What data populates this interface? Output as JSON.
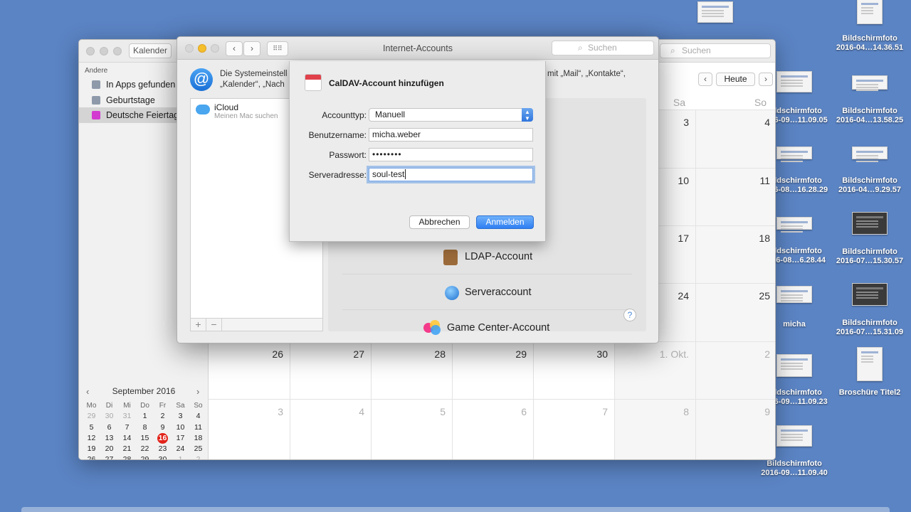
{
  "desktop": {
    "items": [
      {
        "label": ""
      },
      {
        "label": "Bildschirmfoto\n2016-04…14.36.51"
      },
      {
        "label": "Bildschirmfoto\n2016-09…11.09.05"
      },
      {
        "label": "Bildschirmfoto\n2016-04…13.58.25"
      },
      {
        "label": "Bildschirmfoto\n2016-08…16.28.29"
      },
      {
        "label": "Bildschirmfoto\n2016-04…9.29.57"
      },
      {
        "label": "Bildschirmfoto\n2016-08…6.28.44"
      },
      {
        "label": "Bildschirmfoto\n2016-07…15.30.57"
      },
      {
        "label": "micha"
      },
      {
        "label": "Bildschirmfoto\n2016-07…15.31.09"
      },
      {
        "label": "Bildschirmfoto\n2016-09…11.09.23"
      },
      {
        "label": "Broschüre Titel2"
      },
      {
        "label": "Bildschirmfoto\n2016-09…11.09.40"
      }
    ]
  },
  "calendar": {
    "toolbar": {
      "kalender_button": "Kalender",
      "search_placeholder": "Suchen",
      "today_button": "Heute"
    },
    "sidebar": {
      "section": "Andere",
      "items": [
        {
          "label": "In Apps gefunden",
          "color": "#8e9aaa"
        },
        {
          "label": "Geburtstage",
          "color": "#8e9aaa"
        },
        {
          "label": "Deutsche Feiertage",
          "color": "#d23ad0"
        }
      ]
    },
    "mini": {
      "month": "September 2016",
      "dow": [
        "Mo",
        "Di",
        "Mi",
        "Do",
        "Fr",
        "Sa",
        "So"
      ],
      "weeks": [
        [
          "29",
          "30",
          "31",
          "1",
          "2",
          "3",
          "4"
        ],
        [
          "5",
          "6",
          "7",
          "8",
          "9",
          "10",
          "11"
        ],
        [
          "12",
          "13",
          "14",
          "15",
          "16",
          "17",
          "18"
        ],
        [
          "19",
          "20",
          "21",
          "22",
          "23",
          "24",
          "25"
        ],
        [
          "26",
          "27",
          "28",
          "29",
          "30",
          "1",
          "2"
        ],
        [
          "3",
          "4",
          "5",
          "6",
          "7",
          "8",
          "9"
        ]
      ],
      "today": "16"
    },
    "main": {
      "dow": [
        "Sa",
        "So"
      ],
      "rows": [
        [
          "",
          "",
          "",
          "",
          "",
          "3",
          "4"
        ],
        [
          "",
          "",
          "",
          "",
          "",
          "10",
          "11"
        ],
        [
          "",
          "",
          "",
          "",
          "",
          "17",
          "18"
        ],
        [
          "",
          "",
          "",
          "",
          "",
          "24",
          "25"
        ],
        [
          "26",
          "27",
          "28",
          "29",
          "30",
          "1. Okt.",
          "2"
        ],
        [
          "3",
          "4",
          "5",
          "6",
          "7",
          "8",
          "9"
        ]
      ]
    }
  },
  "accounts": {
    "title": "Internet-Accounts",
    "search_placeholder": "Suchen",
    "intro_line1": "Die Systemeinstell",
    "intro_line1_end": "mit „Mail“, „Kontakte“,",
    "intro_line2": "„Kalender“, „Nach",
    "list": [
      {
        "name": "iCloud",
        "sub": "Meinen Mac suchen"
      }
    ],
    "types": [
      {
        "label": "LDAP-Account",
        "icon": "address-book-icon"
      },
      {
        "label": "Serveraccount",
        "icon": "globe-icon"
      },
      {
        "label": "Game Center-Account",
        "icon": "game-center-icon"
      }
    ],
    "help": "?"
  },
  "sheet": {
    "title": "CalDAV-Account hinzufügen",
    "fields": {
      "accounttyp_label": "Accounttyp:",
      "accounttyp_value": "Manuell",
      "benutzername_label": "Benutzername:",
      "benutzername_value": "micha.weber",
      "passwort_label": "Passwort:",
      "passwort_value": "••••••••",
      "server_label": "Serveradresse:",
      "server_value": "soul-test"
    },
    "buttons": {
      "cancel": "Abbrechen",
      "login": "Anmelden"
    }
  }
}
